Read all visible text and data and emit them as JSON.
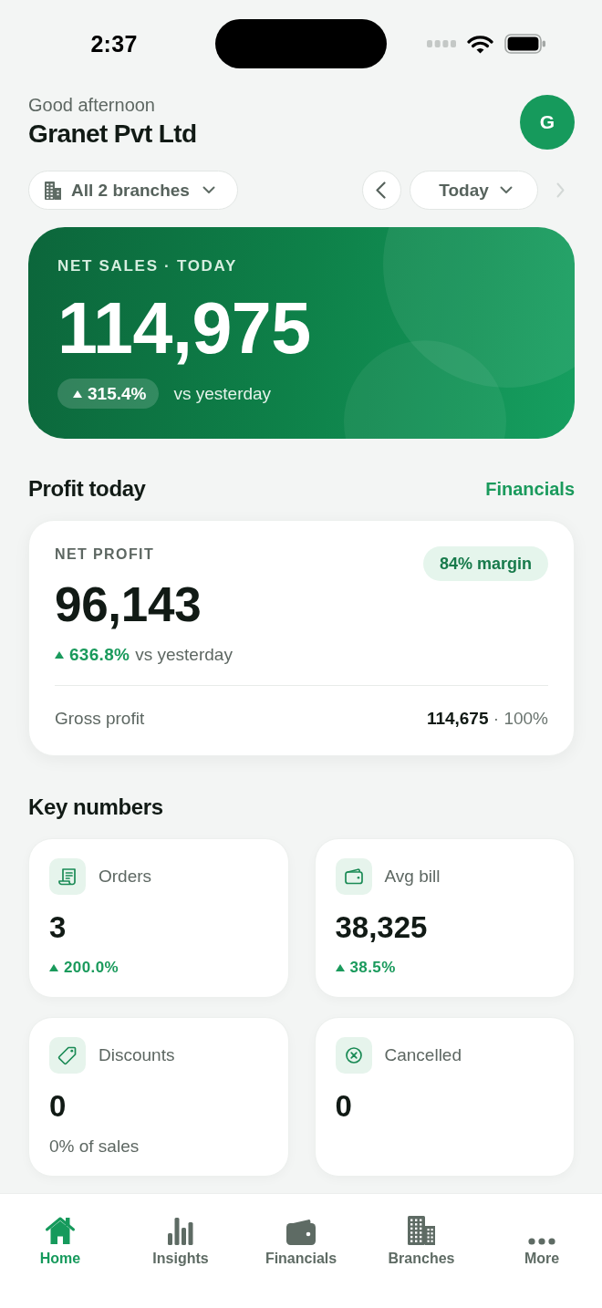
{
  "status_bar": {
    "time": "2:37"
  },
  "header": {
    "greeting": "Good afternoon",
    "business_name": "Granet Pvt Ltd",
    "avatar_initial": "G"
  },
  "filters": {
    "branch": "All 2 branches",
    "period": "Today",
    "next_disabled": true
  },
  "sales_card": {
    "label": "NET SALES · TODAY",
    "value": "114,975",
    "change": "315.4%",
    "rising": true,
    "comparison": "vs yesterday"
  },
  "profit": {
    "title": "Profit today",
    "link": "Financials",
    "label": "NET PROFIT",
    "margin": "84% margin",
    "value": "96,143",
    "change": "636.8%",
    "rising": true,
    "comparison": "vs yesterday",
    "gross_label": "Gross profit",
    "gross_value": "114,675",
    "gross_share": "· 100%"
  },
  "key_numbers": {
    "title": "Key numbers",
    "cards": [
      {
        "kind": "orders",
        "label": "Orders",
        "value": "3",
        "change": "200.0%",
        "rising": true
      },
      {
        "kind": "avg_bill",
        "label": "Avg bill",
        "value": "38,325",
        "change": "38.5%",
        "rising": true
      },
      {
        "kind": "discounts",
        "label": "Discounts",
        "value": "0",
        "note": "0% of sales"
      },
      {
        "kind": "cancelled",
        "label": "Cancelled",
        "value": "0"
      }
    ]
  },
  "tab_bar": [
    {
      "kind": "home",
      "label": "Home",
      "selected": true
    },
    {
      "kind": "insights",
      "label": "Insights",
      "selected": false
    },
    {
      "kind": "financials",
      "label": "Financials",
      "selected": false
    },
    {
      "kind": "branches",
      "label": "Branches",
      "selected": false
    },
    {
      "kind": "more",
      "label": "More",
      "selected": false
    }
  ]
}
